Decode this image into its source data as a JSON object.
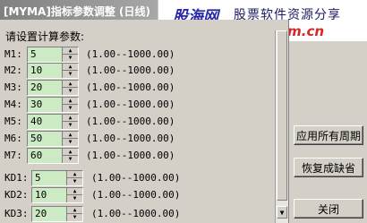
{
  "window": {
    "title": "[MYMA]指标参数调整 (日线)"
  },
  "banner": {
    "brand": "股海网",
    "slogan": "股票软件资源分享",
    "url": "www.Guhai.com.cn"
  },
  "panel": {
    "prompt": "请设置计算参数:"
  },
  "params": [
    {
      "label": "M1:",
      "value": "5",
      "range": "(1.00--1000.00)"
    },
    {
      "label": "M2:",
      "value": "10",
      "range": "(1.00--1000.00)"
    },
    {
      "label": "M3:",
      "value": "20",
      "range": "(1.00--1000.00)"
    },
    {
      "label": "M4:",
      "value": "30",
      "range": "(1.00--1000.00)"
    },
    {
      "label": "M5:",
      "value": "40",
      "range": "(1.00--1000.00)"
    },
    {
      "label": "M6:",
      "value": "50",
      "range": "(1.00--1000.00)"
    },
    {
      "label": "M7:",
      "value": "60",
      "range": "(1.00--1000.00)"
    },
    {
      "label": "KD1:",
      "value": "5",
      "range": "(1.00--1000.00)"
    },
    {
      "label": "KD2:",
      "value": "10",
      "range": "(1.00--1000.00)"
    },
    {
      "label": "KD3:",
      "value": "20",
      "range": "(1.00--1000.00)"
    }
  ],
  "buttons": {
    "apply_all": "应用所有周期",
    "restore_default": "恢复成缺省",
    "close": "关闭"
  },
  "icons": {
    "spin_up": "spin-up-arrow-icon",
    "spin_down": "spin-down-arrow-icon",
    "scroll_down": "scroll-down-arrow-icon"
  }
}
